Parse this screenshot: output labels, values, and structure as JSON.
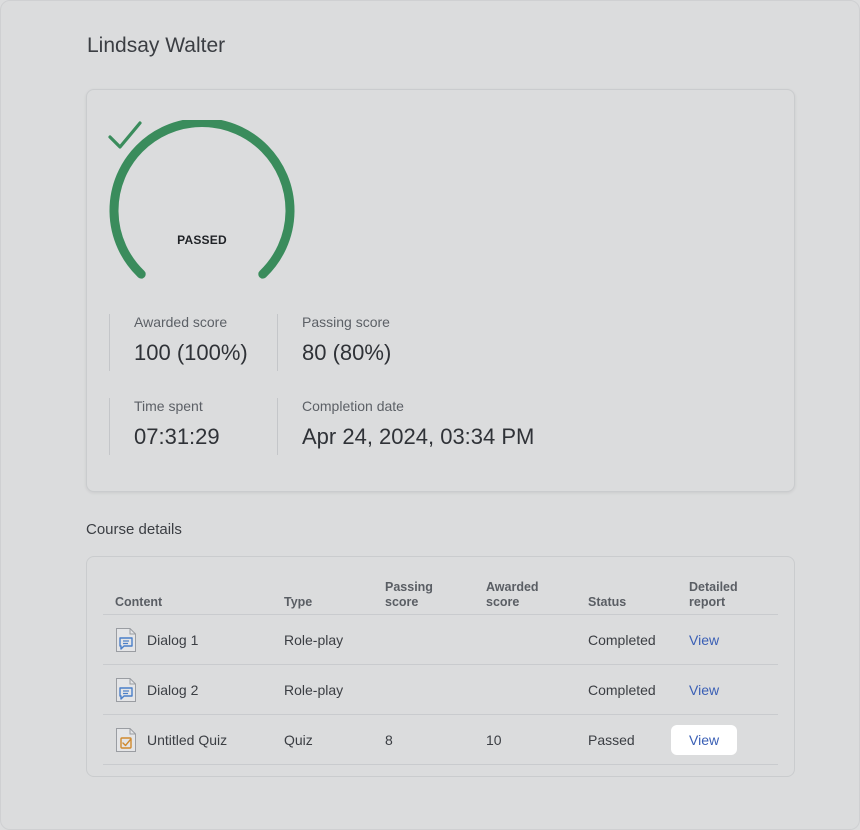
{
  "learner": {
    "name": "Lindsay Walter"
  },
  "result": {
    "status_label": "PASSED",
    "gauge_color": "#3a8c5c"
  },
  "stats": {
    "awarded_score_label": "Awarded score",
    "awarded_score_value": "100 (100%)",
    "passing_score_label": "Passing score",
    "passing_score_value": "80 (80%)",
    "time_spent_label": "Time spent",
    "time_spent_value": "07:31:29",
    "completion_date_label": "Completion date",
    "completion_date_value": "Apr 24, 2024, 03:34 PM"
  },
  "course_details": {
    "title": "Course details",
    "columns": {
      "content": "Content",
      "type": "Type",
      "passing_line1": "Passing",
      "passing_line2": "score",
      "awarded_line1": "Awarded",
      "awarded_line2": "score",
      "status": "Status",
      "report_line1": "Detailed",
      "report_line2": "report"
    },
    "rows": [
      {
        "icon": "dialog-icon",
        "content": "Dialog 1",
        "type": "Role-play",
        "passing_score": "",
        "awarded_score": "",
        "status": "Completed",
        "report_link": "View"
      },
      {
        "icon": "dialog-icon",
        "content": "Dialog 2",
        "type": "Role-play",
        "passing_score": "",
        "awarded_score": "",
        "status": "Completed",
        "report_link": "View"
      },
      {
        "icon": "quiz-icon",
        "content": "Untitled Quiz",
        "type": "Quiz",
        "passing_score": "8",
        "awarded_score": "10",
        "status": "Passed",
        "report_link": "View"
      }
    ]
  },
  "colors": {
    "link": "#3a5fb5",
    "dialog_icon": "#4a7fc9",
    "quiz_icon": "#d08a2e"
  }
}
